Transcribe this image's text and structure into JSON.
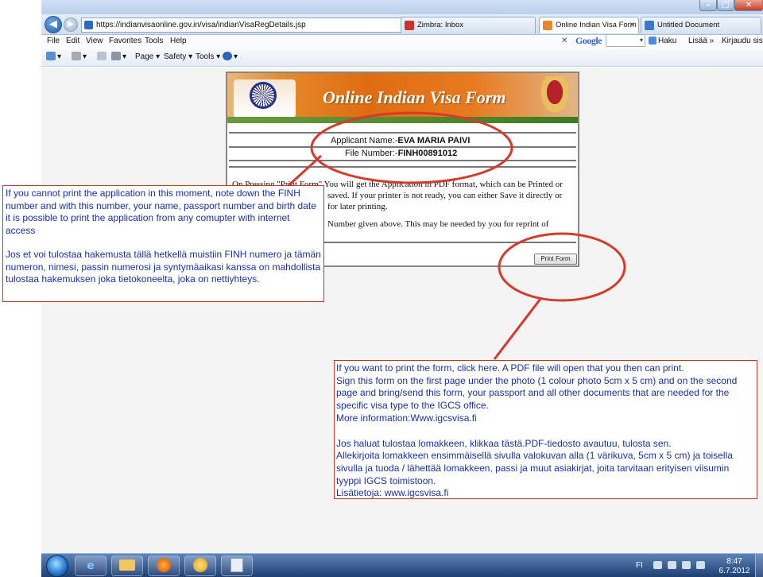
{
  "browser": {
    "url": "https://indianvisaonline.gov.in/visa/indianVisaRegDetails.jsp",
    "tabs": [
      {
        "label": "Zimbra: Inbox"
      },
      {
        "label": "Online Indian Visa Form"
      },
      {
        "label": "Untitled Document"
      }
    ],
    "menu": [
      "File",
      "Edit",
      "View",
      "Favorites",
      "Tools",
      "Help"
    ],
    "google_label": "Google",
    "search_dropdown": "▾",
    "haku_label": "Haku",
    "lisaa_label": "Lisää »",
    "kirjaudu_label": "Kirjaudu sisää",
    "commands": {
      "page": "Page",
      "safety": "Safety",
      "tools": "Tools"
    },
    "close_glyph": "✕",
    "minimize_glyph": "–",
    "maximize_glyph": "□"
  },
  "visa_form": {
    "title": "Online Indian Visa Form",
    "applicant_label": "Applicant Name:-",
    "applicant_value": "EVA MARIA PAIVI",
    "file_label": "File Number:-",
    "file_value": "FINH00891012",
    "notice_lines": [
      "On Pressing \"Print Form\" You will get the Application in PDF format, which can be Printed or",
      "saved. If your printer is not ready, you can either Save it directly or",
      "for later printing.",
      "Number given above. This may be needed by you for reprint of"
    ],
    "print_button": "Print Form"
  },
  "notes": {
    "left_en": "If you cannot print the application in this moment, note down the FINH number and with this number, your name, passport number and birth date it is possible to print the application from any comupter with internet access",
    "left_fi": "Jos et voi tulostaa hakemusta tällä hetkellä muistiin FINH numero ja tämän numeron, nimesi, passin numerosi ja syntymäaikasi kanssa on mahdollista tulostaa hakemuksen joka tietokoneelta, joka on nettiyhteys.",
    "right_en_1": "If you want to print the form, click here. A PDF file will open that you then can print.",
    "right_en_2": "Sign this form on the first page under the photo (1 colour photo 5cm x 5 cm) and on the second page and bring/send this form, your passport and all other documents that are needed for the specific visa type to the IGCS office.",
    "right_en_3": "More information:Www.igcsvisa.fi",
    "right_fi_1": "Jos haluat tulostaa lomakkeen, klikkaa tästä.PDF-tiedosto avautuu, tulosta sen.",
    "right_fi_2": "Allekirjoita  lomakkeen ensimmäisellä sivulla valokuvan alla (1 värikuva, 5cm x 5 cm) ja toisella sivulla ja tuoda / lähettää lomakkeen, passi ja muut asiakirjat, joita tarvitaan erityisen viisumin tyyppi IGCS toimistoon.",
    "right_fi_3": "Lisätietoja: www.igcsvisa.fi"
  },
  "taskbar": {
    "lang": "FI",
    "time": "8:47",
    "date": "6.7.2012"
  },
  "colors": {
    "annotation_red": "#d63a2a",
    "annotation_text": "#1a2fa8"
  }
}
